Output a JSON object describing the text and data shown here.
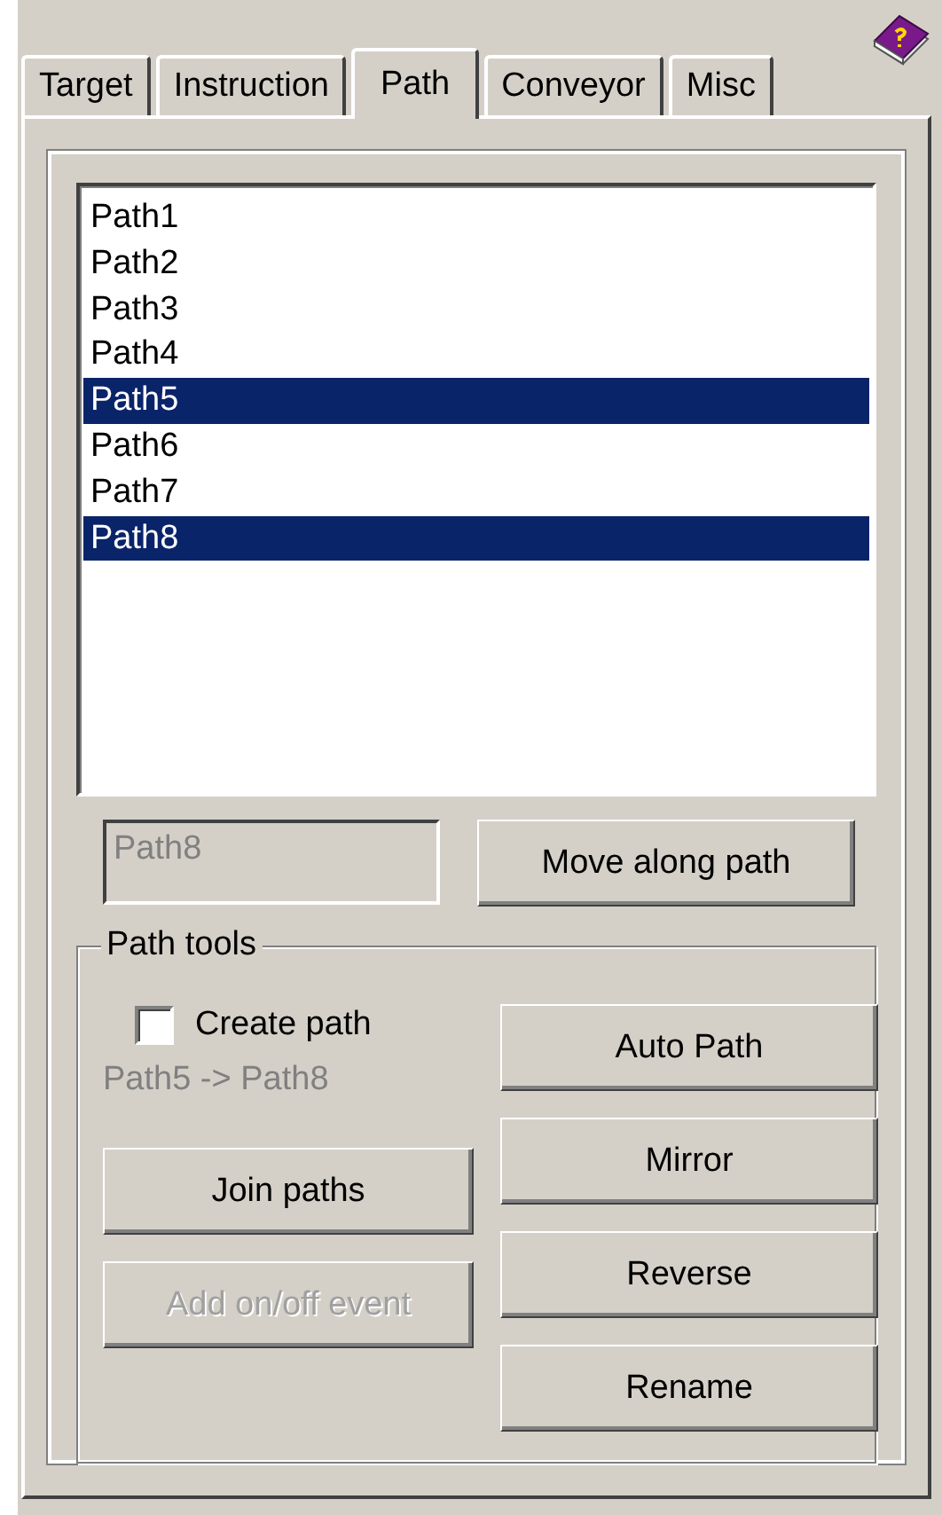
{
  "tabs": [
    {
      "label": "Target",
      "selected": false
    },
    {
      "label": "Instruction",
      "selected": false
    },
    {
      "label": "Path",
      "selected": true
    },
    {
      "label": "Conveyor",
      "selected": false
    },
    {
      "label": "Misc",
      "selected": false
    }
  ],
  "path_list": {
    "items": [
      {
        "label": "Path1",
        "selected": false
      },
      {
        "label": "Path2",
        "selected": false
      },
      {
        "label": "Path3",
        "selected": false
      },
      {
        "label": "Path4",
        "selected": false
      },
      {
        "label": "Path5",
        "selected": true
      },
      {
        "label": "Path6",
        "selected": false
      },
      {
        "label": "Path7",
        "selected": false
      },
      {
        "label": "Path8",
        "selected": true
      }
    ]
  },
  "name_field": {
    "value": "Path8",
    "disabled": true
  },
  "move_button": {
    "label": "Move along path",
    "disabled": false
  },
  "path_tools": {
    "title": "Path tools",
    "create_path": {
      "label": "Create path",
      "checked": false
    },
    "selection_info": "Path5 -> Path8",
    "left_buttons": [
      {
        "label": "Join paths",
        "disabled": false
      },
      {
        "label": "Add on/off event",
        "disabled": true
      }
    ],
    "right_buttons": [
      {
        "label": "Auto Path",
        "disabled": false
      },
      {
        "label": "Mirror",
        "disabled": false
      },
      {
        "label": "Reverse",
        "disabled": false
      },
      {
        "label": "Rename",
        "disabled": false
      }
    ]
  }
}
